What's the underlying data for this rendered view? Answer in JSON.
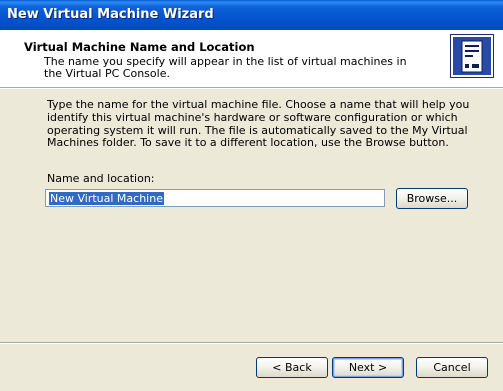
{
  "window": {
    "title": "New Virtual Machine Wizard"
  },
  "header": {
    "heading": "Virtual Machine Name and Location",
    "subheading": "The name you specify will appear in the list of virtual machines in the Virtual PC Console.",
    "icon": "computer-tower-icon"
  },
  "body": {
    "description": "Type the name for the virtual machine file. Choose a name that will help you identify this virtual machine's hardware or software configuration or which operating system it will run. The file is automatically saved to the My Virtual Machines folder. To save it to a different location, use the Browse button.",
    "field_label": "Name and location:",
    "name_value": "New Virtual Machine",
    "browse_label": "Browse..."
  },
  "footer": {
    "back_label": "< Back",
    "next_label": "Next >",
    "cancel_label": "Cancel"
  },
  "colors": {
    "titlebar": "#0554d0",
    "dialog_bg": "#ece9d8",
    "selection": "#316ac5"
  }
}
